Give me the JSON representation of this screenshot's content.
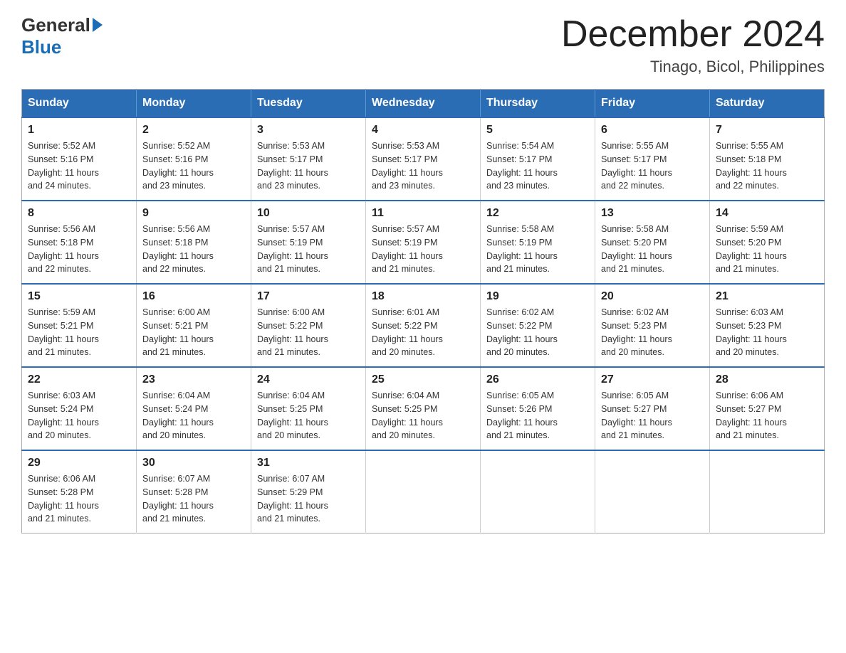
{
  "logo": {
    "general": "General",
    "blue": "Blue"
  },
  "title": {
    "month_year": "December 2024",
    "location": "Tinago, Bicol, Philippines"
  },
  "headers": [
    "Sunday",
    "Monday",
    "Tuesday",
    "Wednesday",
    "Thursday",
    "Friday",
    "Saturday"
  ],
  "weeks": [
    [
      {
        "day": "1",
        "info": "Sunrise: 5:52 AM\nSunset: 5:16 PM\nDaylight: 11 hours\nand 24 minutes."
      },
      {
        "day": "2",
        "info": "Sunrise: 5:52 AM\nSunset: 5:16 PM\nDaylight: 11 hours\nand 23 minutes."
      },
      {
        "day": "3",
        "info": "Sunrise: 5:53 AM\nSunset: 5:17 PM\nDaylight: 11 hours\nand 23 minutes."
      },
      {
        "day": "4",
        "info": "Sunrise: 5:53 AM\nSunset: 5:17 PM\nDaylight: 11 hours\nand 23 minutes."
      },
      {
        "day": "5",
        "info": "Sunrise: 5:54 AM\nSunset: 5:17 PM\nDaylight: 11 hours\nand 23 minutes."
      },
      {
        "day": "6",
        "info": "Sunrise: 5:55 AM\nSunset: 5:17 PM\nDaylight: 11 hours\nand 22 minutes."
      },
      {
        "day": "7",
        "info": "Sunrise: 5:55 AM\nSunset: 5:18 PM\nDaylight: 11 hours\nand 22 minutes."
      }
    ],
    [
      {
        "day": "8",
        "info": "Sunrise: 5:56 AM\nSunset: 5:18 PM\nDaylight: 11 hours\nand 22 minutes."
      },
      {
        "day": "9",
        "info": "Sunrise: 5:56 AM\nSunset: 5:18 PM\nDaylight: 11 hours\nand 22 minutes."
      },
      {
        "day": "10",
        "info": "Sunrise: 5:57 AM\nSunset: 5:19 PM\nDaylight: 11 hours\nand 21 minutes."
      },
      {
        "day": "11",
        "info": "Sunrise: 5:57 AM\nSunset: 5:19 PM\nDaylight: 11 hours\nand 21 minutes."
      },
      {
        "day": "12",
        "info": "Sunrise: 5:58 AM\nSunset: 5:19 PM\nDaylight: 11 hours\nand 21 minutes."
      },
      {
        "day": "13",
        "info": "Sunrise: 5:58 AM\nSunset: 5:20 PM\nDaylight: 11 hours\nand 21 minutes."
      },
      {
        "day": "14",
        "info": "Sunrise: 5:59 AM\nSunset: 5:20 PM\nDaylight: 11 hours\nand 21 minutes."
      }
    ],
    [
      {
        "day": "15",
        "info": "Sunrise: 5:59 AM\nSunset: 5:21 PM\nDaylight: 11 hours\nand 21 minutes."
      },
      {
        "day": "16",
        "info": "Sunrise: 6:00 AM\nSunset: 5:21 PM\nDaylight: 11 hours\nand 21 minutes."
      },
      {
        "day": "17",
        "info": "Sunrise: 6:00 AM\nSunset: 5:22 PM\nDaylight: 11 hours\nand 21 minutes."
      },
      {
        "day": "18",
        "info": "Sunrise: 6:01 AM\nSunset: 5:22 PM\nDaylight: 11 hours\nand 20 minutes."
      },
      {
        "day": "19",
        "info": "Sunrise: 6:02 AM\nSunset: 5:22 PM\nDaylight: 11 hours\nand 20 minutes."
      },
      {
        "day": "20",
        "info": "Sunrise: 6:02 AM\nSunset: 5:23 PM\nDaylight: 11 hours\nand 20 minutes."
      },
      {
        "day": "21",
        "info": "Sunrise: 6:03 AM\nSunset: 5:23 PM\nDaylight: 11 hours\nand 20 minutes."
      }
    ],
    [
      {
        "day": "22",
        "info": "Sunrise: 6:03 AM\nSunset: 5:24 PM\nDaylight: 11 hours\nand 20 minutes."
      },
      {
        "day": "23",
        "info": "Sunrise: 6:04 AM\nSunset: 5:24 PM\nDaylight: 11 hours\nand 20 minutes."
      },
      {
        "day": "24",
        "info": "Sunrise: 6:04 AM\nSunset: 5:25 PM\nDaylight: 11 hours\nand 20 minutes."
      },
      {
        "day": "25",
        "info": "Sunrise: 6:04 AM\nSunset: 5:25 PM\nDaylight: 11 hours\nand 20 minutes."
      },
      {
        "day": "26",
        "info": "Sunrise: 6:05 AM\nSunset: 5:26 PM\nDaylight: 11 hours\nand 21 minutes."
      },
      {
        "day": "27",
        "info": "Sunrise: 6:05 AM\nSunset: 5:27 PM\nDaylight: 11 hours\nand 21 minutes."
      },
      {
        "day": "28",
        "info": "Sunrise: 6:06 AM\nSunset: 5:27 PM\nDaylight: 11 hours\nand 21 minutes."
      }
    ],
    [
      {
        "day": "29",
        "info": "Sunrise: 6:06 AM\nSunset: 5:28 PM\nDaylight: 11 hours\nand 21 minutes."
      },
      {
        "day": "30",
        "info": "Sunrise: 6:07 AM\nSunset: 5:28 PM\nDaylight: 11 hours\nand 21 minutes."
      },
      {
        "day": "31",
        "info": "Sunrise: 6:07 AM\nSunset: 5:29 PM\nDaylight: 11 hours\nand 21 minutes."
      },
      {
        "day": "",
        "info": ""
      },
      {
        "day": "",
        "info": ""
      },
      {
        "day": "",
        "info": ""
      },
      {
        "day": "",
        "info": ""
      }
    ]
  ]
}
